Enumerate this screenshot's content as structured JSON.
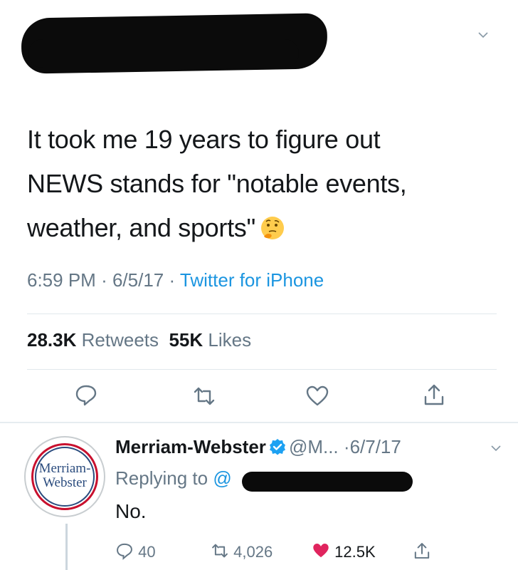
{
  "tweet": {
    "text_line1": "It took me 19 years to figure out",
    "text_line2": "NEWS stands for \"notable events,",
    "text_line3": "weather, and sports\"",
    "emoji": "thinking-face-icon",
    "time": "6:59 PM",
    "date": "6/5/17",
    "source": "Twitter for iPhone",
    "retweets_count": "28.3K",
    "retweets_label": "Retweets",
    "likes_count": "55K",
    "likes_label": "Likes"
  },
  "reply": {
    "avatar_line1": "Merriam-",
    "avatar_line2": "Webster",
    "name": "Merriam-Webster",
    "handle": "@M...",
    "date": "·6/7/17",
    "replying_prefix": "Replying to",
    "replying_at": "@",
    "text": "No.",
    "reply_count": "40",
    "retweet_count": "4,026",
    "like_count": "12.5K"
  },
  "colors": {
    "link": "#1b95e0",
    "muted": "#657786",
    "heart": "#e0245e",
    "verified": "#1da1f2"
  }
}
